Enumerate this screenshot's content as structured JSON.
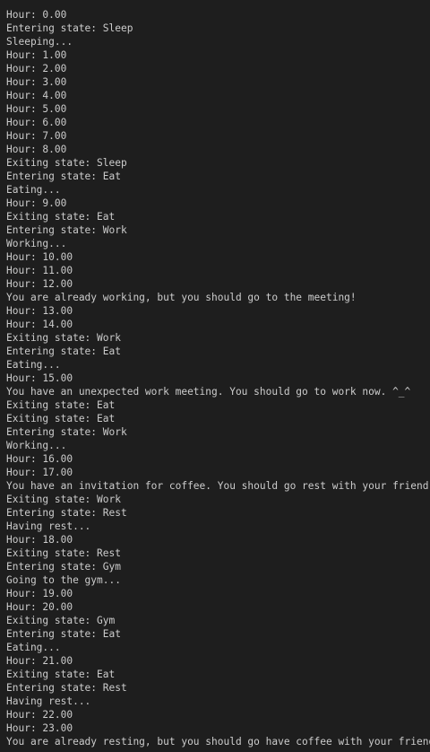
{
  "terminal": {
    "lines": [
      "Hour: 0.00",
      "Entering state: Sleep",
      "Sleeping...",
      "Hour: 1.00",
      "Hour: 2.00",
      "Hour: 3.00",
      "Hour: 4.00",
      "Hour: 5.00",
      "Hour: 6.00",
      "Hour: 7.00",
      "Hour: 8.00",
      "Exiting state: Sleep",
      "Entering state: Eat",
      "Eating...",
      "Hour: 9.00",
      "Exiting state: Eat",
      "Entering state: Work",
      "Working...",
      "Hour: 10.00",
      "Hour: 11.00",
      "Hour: 12.00",
      "You are already working, but you should go to the meeting!",
      "Hour: 13.00",
      "Hour: 14.00",
      "Exiting state: Work",
      "Entering state: Eat",
      "Eating...",
      "Hour: 15.00",
      "You have an unexpected work meeting. You should go to work now. ^_^",
      "Exiting state: Eat",
      "Exiting state: Eat",
      "Entering state: Work",
      "Working...",
      "Hour: 16.00",
      "Hour: 17.00",
      "You have an invitation for coffee. You should go rest with your friend :)",
      "Exiting state: Work",
      "Entering state: Rest",
      "Having rest...",
      "Hour: 18.00",
      "Exiting state: Rest",
      "Entering state: Gym",
      "Going to the gym...",
      "Hour: 19.00",
      "Hour: 20.00",
      "Exiting state: Gym",
      "Entering state: Eat",
      "Eating...",
      "Hour: 21.00",
      "Exiting state: Eat",
      "Entering state: Rest",
      "Having rest...",
      "Hour: 22.00",
      "Hour: 23.00",
      "You are already resting, but you should go have coffee with your friend! :)"
    ]
  }
}
